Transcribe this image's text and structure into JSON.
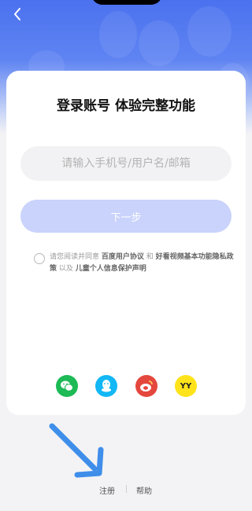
{
  "header": {
    "back_icon": "chevron-left-icon"
  },
  "card": {
    "title": "登录账号 体验完整功能",
    "input_placeholder": "请输入手机号/用户名/邮箱",
    "next_label": "下一步"
  },
  "agreement": {
    "prefix": "请您阅读并同意",
    "link1": "百度用户协议",
    "and": "和",
    "link2": "好看视频基本功能隐私政策",
    "also": "以及",
    "link3": "儿童个人信息保护声明"
  },
  "social": [
    {
      "icon": "wechat-icon",
      "color": "#1dba56"
    },
    {
      "icon": "qq-icon",
      "color": "#12b7f5"
    },
    {
      "icon": "weibo-icon",
      "color": "#e4473d"
    },
    {
      "icon": "yy-icon",
      "color": "#ffe31a",
      "text": "YY"
    }
  ],
  "footer": {
    "register": "注册",
    "help": "帮助"
  },
  "colors": {
    "header": "#4b71ef",
    "button": "#c9d3fb",
    "annotation_arrow": "#3f8eea"
  }
}
